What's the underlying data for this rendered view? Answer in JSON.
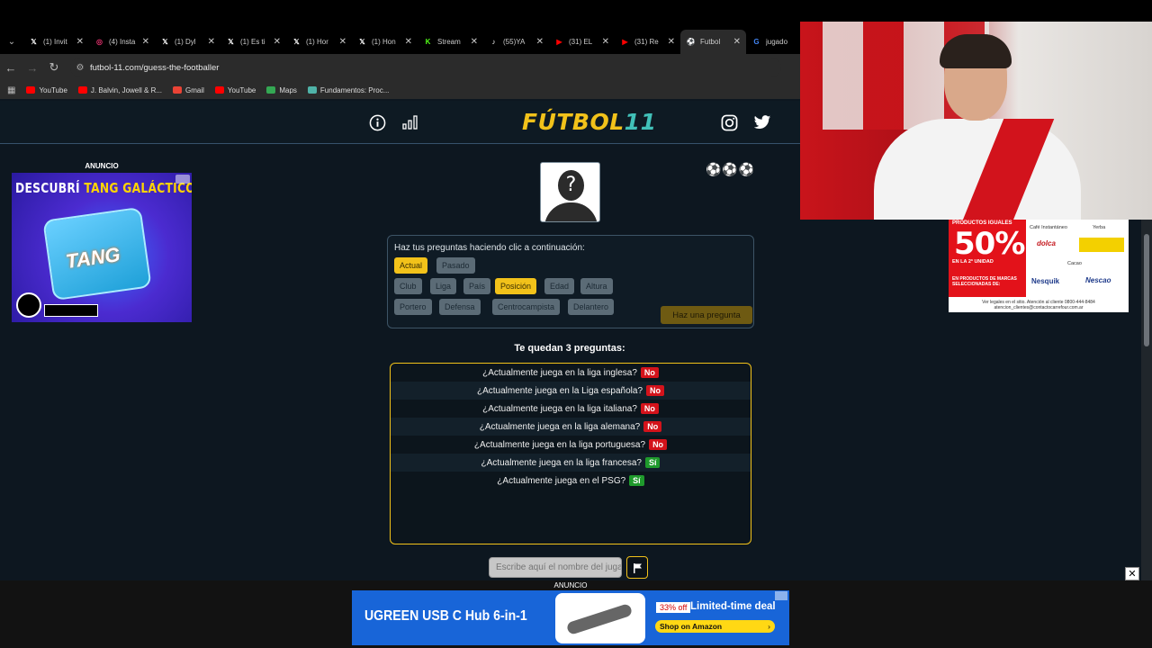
{
  "browser": {
    "tabs": [
      {
        "title": "(1) Invit",
        "icon": "x-logo-icon",
        "color": "#ffffff"
      },
      {
        "title": "(4) Insta",
        "icon": "instagram-icon",
        "color": "#e1306c"
      },
      {
        "title": "(1) Dyl",
        "icon": "x-logo-icon",
        "color": "#ffffff"
      },
      {
        "title": "(1) Es ti",
        "icon": "x-logo-icon",
        "color": "#ffffff"
      },
      {
        "title": "(1) Hor",
        "icon": "x-logo-icon",
        "color": "#ffffff"
      },
      {
        "title": "(1) Hon",
        "icon": "x-logo-icon",
        "color": "#ffffff"
      },
      {
        "title": "Stream",
        "icon": "kick-icon",
        "color": "#53fc18"
      },
      {
        "title": "(55)YA",
        "icon": "tiktok-icon",
        "color": "#ffffff"
      },
      {
        "title": "(31) EL",
        "icon": "youtube-icon",
        "color": "#ff0000"
      },
      {
        "title": "(31) Re",
        "icon": "youtube-icon",
        "color": "#ff0000"
      },
      {
        "title": "Futbol",
        "icon": "futbol11-icon",
        "color": "#2b7bd8",
        "active": true
      },
      {
        "title": "jugado",
        "icon": "google-icon",
        "color": "#4285f4"
      }
    ],
    "url": "futbol-11.com/guess-the-footballer",
    "bookmarks": [
      {
        "label": "YouTube",
        "color": "#ff0000"
      },
      {
        "label": "J. Balvin, Jowell & R...",
        "color": "#ff0000"
      },
      {
        "label": "Gmail",
        "color": "#ea4335"
      },
      {
        "label": "YouTube",
        "color": "#ff0000"
      },
      {
        "label": "Maps",
        "color": "#34a853"
      },
      {
        "label": "Fundamentos: Proc...",
        "color": "#4fb3a8"
      }
    ]
  },
  "site": {
    "logo_main": "FÚTBOL",
    "logo_accent": "11",
    "left_ad_label": "ANUNCIO",
    "left_ad": {
      "headline_a": "DESCUBRÍ",
      "headline_b": "TANG GALÁCTICO",
      "brand": "TANG"
    },
    "lives": "⚽⚽⚽",
    "hint": "Haz tus preguntas haciendo clic a continuación:",
    "time_chips": [
      {
        "label": "Actual",
        "selected": true
      },
      {
        "label": "Pasado",
        "selected": false
      }
    ],
    "category_chips": [
      {
        "label": "Club",
        "selected": false
      },
      {
        "label": "Liga",
        "selected": false
      },
      {
        "label": "País",
        "selected": false
      },
      {
        "label": "Posición",
        "selected": true
      },
      {
        "label": "Edad",
        "selected": false
      },
      {
        "label": "Altura",
        "selected": false
      }
    ],
    "position_chips": [
      {
        "label": "Portero",
        "selected": false
      },
      {
        "label": "Defensa",
        "selected": false
      },
      {
        "label": "Centrocampista",
        "selected": false
      },
      {
        "label": "Delantero",
        "selected": false
      }
    ],
    "ask_button": "Haz una pregunta",
    "remaining": "Te quedan 3 preguntas:",
    "answers": [
      {
        "q": "¿Actualmente juega en la liga inglesa?",
        "a": "No"
      },
      {
        "q": "¿Actualmente juega en la Liga española?",
        "a": "No"
      },
      {
        "q": "¿Actualmente juega en la liga italiana?",
        "a": "No"
      },
      {
        "q": "¿Actualmente juega en la liga alemana?",
        "a": "No"
      },
      {
        "q": "¿Actualmente juega en la liga portuguesa?",
        "a": "No"
      },
      {
        "q": "¿Actualmente juega en la liga francesa?",
        "a": "Sí"
      },
      {
        "q": "¿Actualmente juega en el PSG?",
        "a": "Sí"
      }
    ],
    "guess_placeholder": "Escribe aquí el nombre del jugador",
    "colors": {
      "accent": "#f2c21a",
      "teal": "#41c0b8",
      "no": "#d4131b",
      "si": "#1f9a2c"
    }
  },
  "bottom_ad": {
    "label": "ANUNCIO",
    "brand": "UGREEN USB C Hub 6-in-1",
    "discount": "33% off",
    "deal": "Limited-time deal",
    "cta": "Shop on Amazon",
    "close": "✕"
  },
  "right_ad": {
    "top": "PRODUCTOS IGUALES",
    "percent": "50%",
    "unit": "EN LA 2ª UNIDAD",
    "sub": "EN PRODUCTOS DE MARCAS SELECCIONADAS DE:",
    "cat1": "Café Instantáneo",
    "cat2": "Yerba",
    "cat3": "Cacao",
    "brand1": "dolca",
    "brand2": "Nesquik",
    "brand3": "Nescao",
    "legal": "Ver legales en el sitio. Atención al cliente 0800-444-8484 atencion_clientes@contactocarrefour.com.ar"
  }
}
